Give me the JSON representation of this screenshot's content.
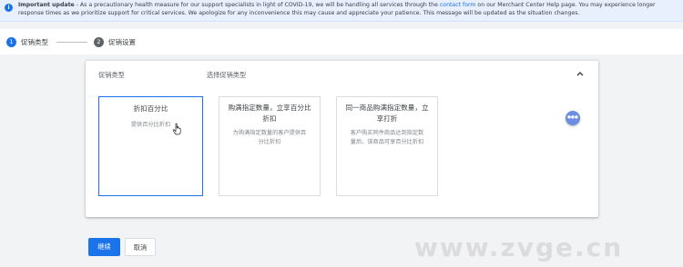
{
  "banner": {
    "icon": "info-icon",
    "bold_text": "Important update",
    "text_before_link": " - As a precautionary health measure for our support specialists in light of COVID-19, we will be handling all services through the ",
    "link_text": "contact form",
    "text_after_link": " on our Merchant Center Help page. You may experience longer response times as we prioritize support for critical services. We apologize for any inconvenience this may cause and appreciate your patience. This message will be updated as the situation changes."
  },
  "stepper": {
    "steps": [
      {
        "number": "1",
        "label": "促销类型"
      },
      {
        "number": "2",
        "label": "促销设置"
      }
    ]
  },
  "panel": {
    "type_label": "促销类型",
    "select_label": "选择促销类型",
    "options": [
      {
        "title": "折扣百分比",
        "description": "提供百分比折扣"
      },
      {
        "title": "购满指定数量，立享百分比折扣",
        "description": "为购满指定数量的客户提供百分比折扣"
      },
      {
        "title": "同一商品购满指定数量，立享打折",
        "description": "客户购买同件商品达到指定数量后，该商品可享百分比折扣"
      }
    ]
  },
  "actions": {
    "continue_label": "继续",
    "cancel_label": "取消"
  },
  "watermark": "www.zvge.cn",
  "colors": {
    "accent": "#1a73e8",
    "banner_bg": "#e8f0fe",
    "page_bg": "#f1f3f4"
  }
}
